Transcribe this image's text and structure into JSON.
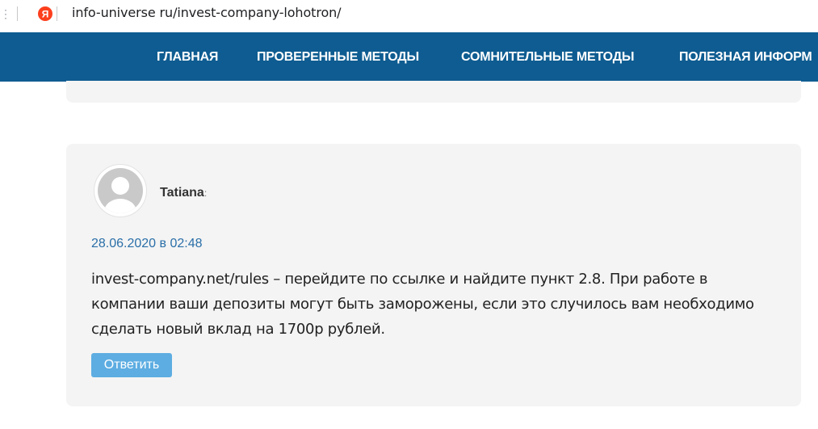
{
  "browser": {
    "url": "info-universe ru/invest-company-lohotron/",
    "left_glyph": "⋮",
    "favicon_letter": "Я"
  },
  "nav": {
    "items": [
      {
        "label": "ГЛАВНАЯ"
      },
      {
        "label": "ПРОВЕРЕННЫЕ МЕТОДЫ"
      },
      {
        "label": "СОМНИТЕЛЬНЫЕ МЕТОДЫ"
      },
      {
        "label": "ПОЛЕЗНАЯ ИНФОРМ"
      }
    ]
  },
  "comment": {
    "author": "Tatiana",
    "author_suffix": ":",
    "date": "28.06.2020 в 02:48",
    "text_lines": [
      "invest-company.net/rules – перейдите по ссылке и найдите пункт 2.8. При работе в",
      "компании ваши депозиты могут быть заморожены, если это случилось вам необходимо",
      "сделать новый вклад на 1700р рублей."
    ],
    "reply_label": "Ответить"
  },
  "colors": {
    "nav_bg": "#0e5c91",
    "date": "#2a6fa8",
    "reply_bg": "#5dade2",
    "card_bg": "#f4f4f4",
    "yandex_red": "#fc3f1d"
  }
}
